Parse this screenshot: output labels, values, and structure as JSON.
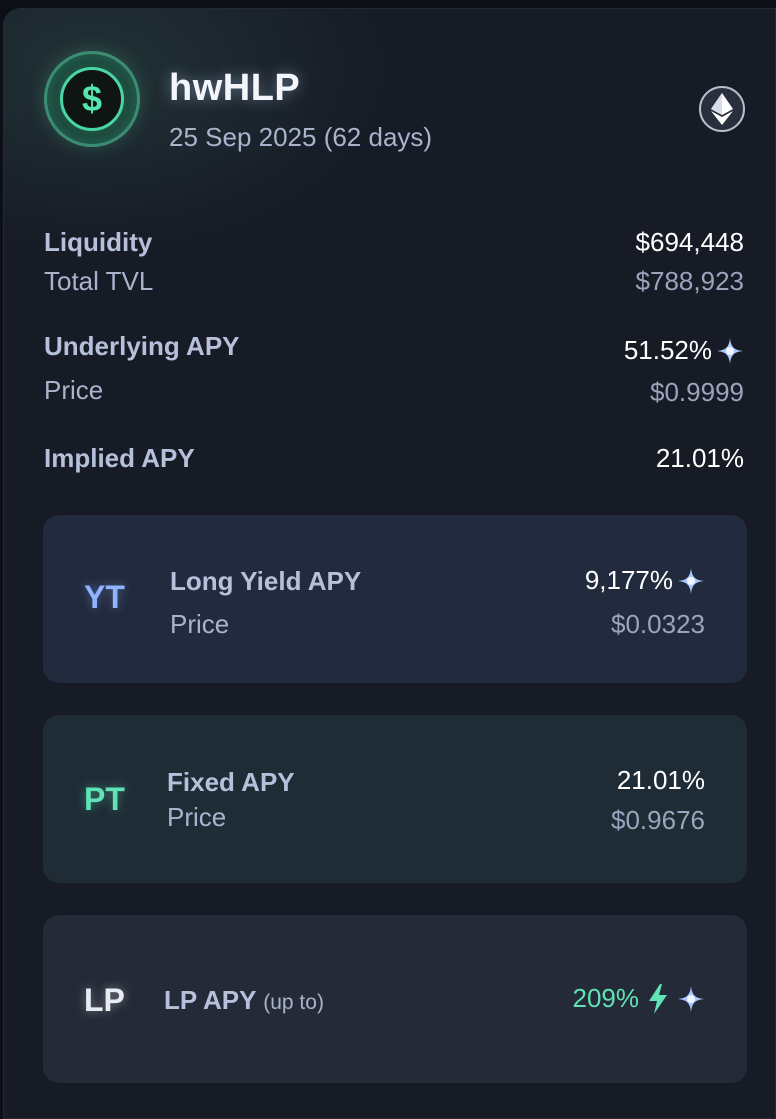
{
  "header": {
    "logo_symbol": "$",
    "title": "hwHLP",
    "expiry": "25 Sep 2025 (62 days)",
    "chain_icon": "ethereum-icon"
  },
  "stats": {
    "liquidity_label": "Liquidity",
    "liquidity_value": "$694,448",
    "tvl_label": "Total TVL",
    "tvl_value": "$788,923",
    "underlying_apy_label": "Underlying APY",
    "underlying_apy_value": "51.52%",
    "price_label": "Price",
    "price_value": "$0.9999",
    "implied_apy_label": "Implied APY",
    "implied_apy_value": "21.01%"
  },
  "yt": {
    "tag": "YT",
    "label": "Long Yield APY",
    "value": "9,177%",
    "price_label": "Price",
    "price_value": "$0.0323"
  },
  "pt": {
    "tag": "PT",
    "label": "Fixed APY",
    "value": "21.01%",
    "price_label": "Price",
    "price_value": "$0.9676"
  },
  "lp": {
    "tag": "LP",
    "label": "LP APY",
    "label_suffix": "(up to)",
    "value": "209%"
  },
  "colors": {
    "yt_accent": "#8fb3ff",
    "pt_accent": "#5fe3b4",
    "lp_value": "#5fe3b4",
    "sparkle": "#a9c8ff"
  }
}
